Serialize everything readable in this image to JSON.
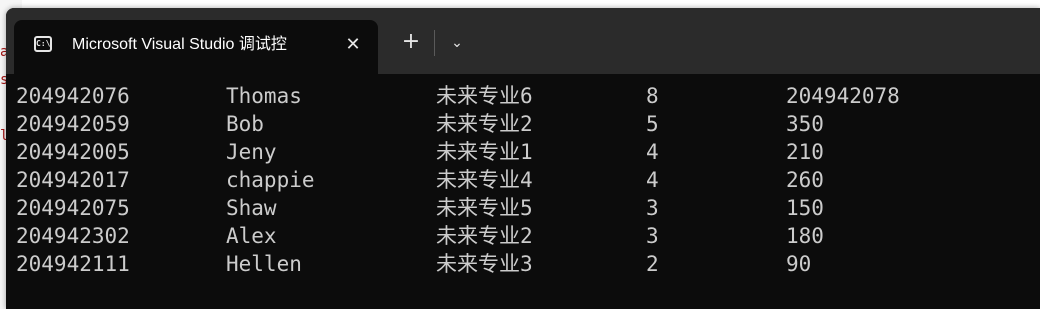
{
  "background_window": {
    "edge_chars": [
      "a",
      "s",
      "l"
    ]
  },
  "window": {
    "tab_title": "Microsoft Visual Studio 调试控",
    "tab_icon": "console-icon",
    "close_glyph": "✕",
    "new_tab_glyph": "+",
    "dropdown_glyph": "⌄"
  },
  "console": {
    "rows": [
      [
        "204942076",
        "Thomas",
        "未来专业6",
        "8",
        "204942078"
      ],
      [
        "204942059",
        "Bob",
        "未来专业2",
        "5",
        "350"
      ],
      [
        "204942005",
        "Jeny",
        "未来专业1",
        "4",
        "210"
      ],
      [
        "204942017",
        "chappie",
        "未来专业4",
        "4",
        "260"
      ],
      [
        "204942075",
        "Shaw",
        "未来专业5",
        "3",
        "150"
      ],
      [
        "204942302",
        "Alex",
        "未来专业2",
        "3",
        "180"
      ],
      [
        "204942111",
        "Hellen",
        "未来专业3",
        "2",
        "90"
      ]
    ]
  },
  "colors": {
    "console_bg": "#0c0c0c",
    "console_text": "#cccccc",
    "titlebar": "#2b2b2b"
  }
}
